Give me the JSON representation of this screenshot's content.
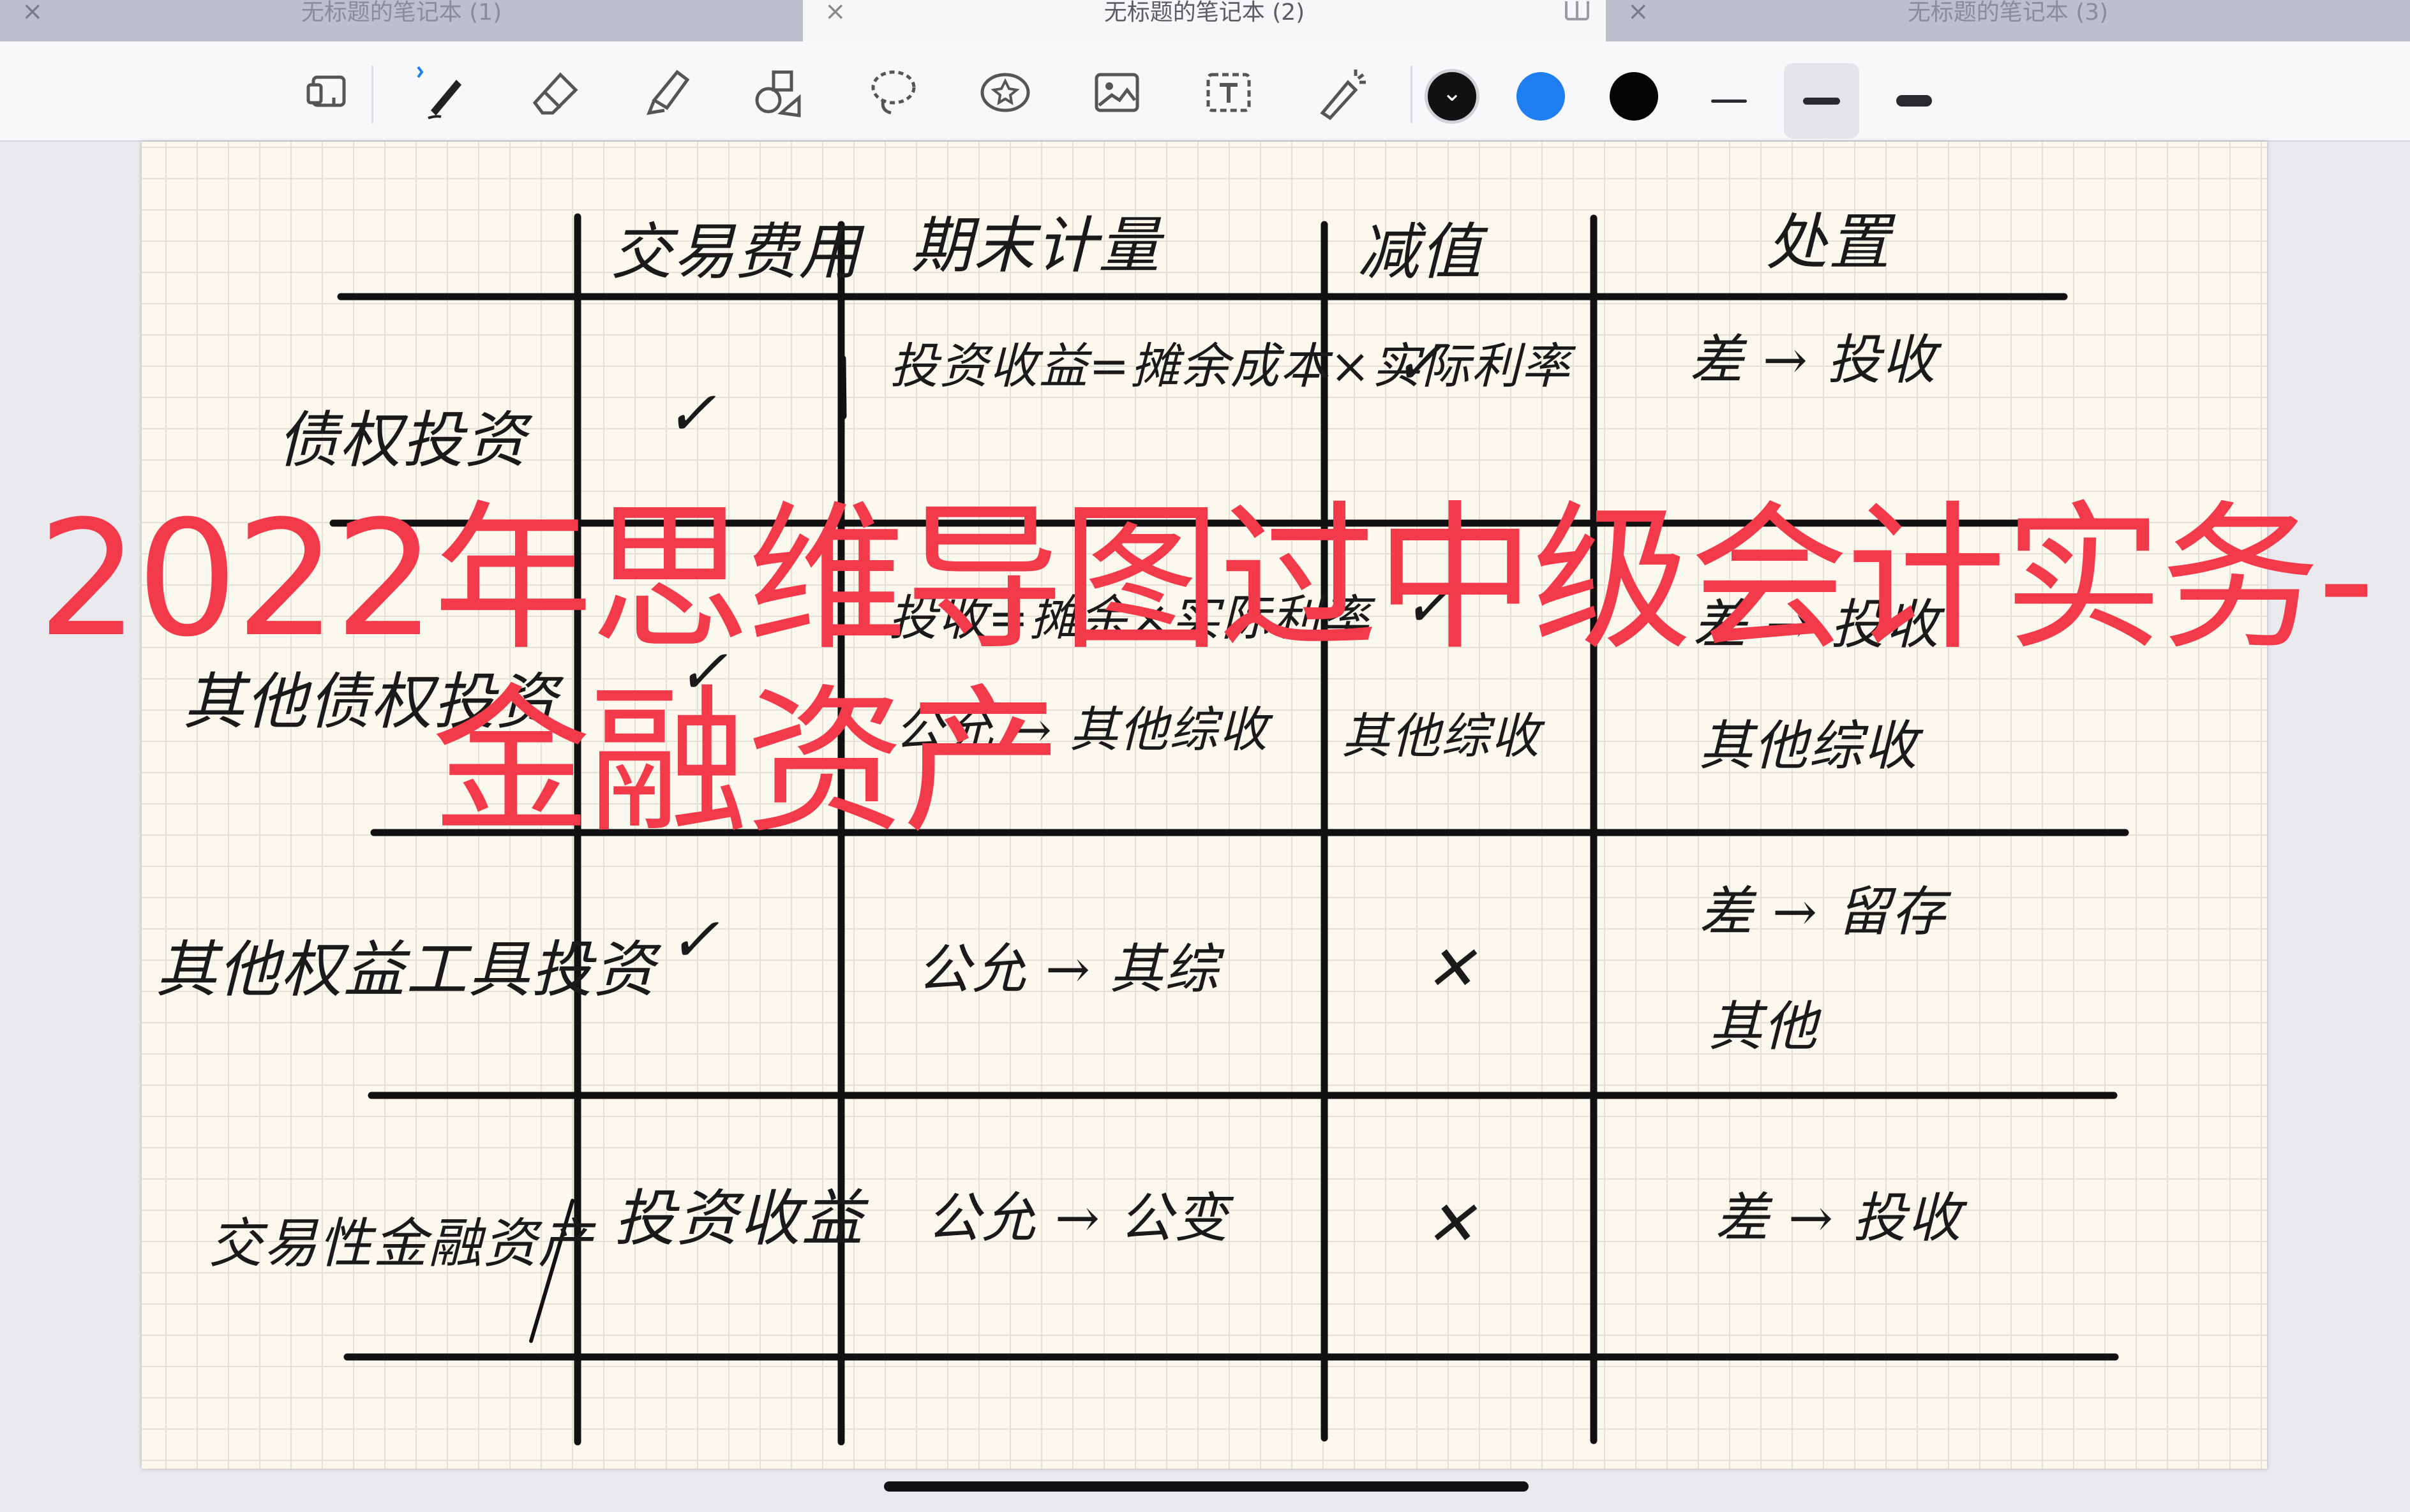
{
  "tabs": [
    {
      "title": "无标题的笔记本 (1)",
      "close": "×"
    },
    {
      "title": "无标题的笔记本 (2)",
      "close": "×"
    },
    {
      "title": "无标题的笔记本 (3)",
      "close": "×"
    }
  ],
  "toolbar": {
    "tools": [
      "page-layout-icon",
      "bluetooth-icon",
      "pen-icon",
      "eraser-icon",
      "highlighter-icon",
      "shapes-icon",
      "lasso-icon",
      "sticker-icon",
      "image-icon",
      "text-icon",
      "laser-pointer-icon"
    ],
    "colors": [
      "#111111",
      "#1f7ff0",
      "#000000"
    ],
    "chevron": "⌄"
  },
  "table": {
    "headers": [
      "交易费用",
      "期末计量",
      "减值",
      "处置"
    ],
    "rows": [
      {
        "label": "债权投资",
        "fee": "✓",
        "measure": "投资收益=摊余成本×实际利率",
        "impair": "✓",
        "dispose": "差 → 投收"
      },
      {
        "label": "其他债权投资",
        "fee": "✓",
        "measure": "投收=摊余×实际利率",
        "measure2": "公允 → 其他综收",
        "impair": "✓",
        "impair2": "其他综收",
        "dispose": "差 → 投收",
        "dispose2": "其他综收"
      },
      {
        "label": "其他权益工具投资",
        "fee": "✓",
        "measure": "公允 → 其综",
        "impair": "✕",
        "dispose": "差 → 留存",
        "dispose2": "其他"
      },
      {
        "label": "交易性金融资产",
        "fee": "投资收益",
        "measure": "公允 → 公变",
        "impair": "✕",
        "dispose": "差 → 投收"
      }
    ]
  },
  "overlay": {
    "line1": "2022年思维导图过中级会计实务-",
    "line2": "金融资产"
  }
}
